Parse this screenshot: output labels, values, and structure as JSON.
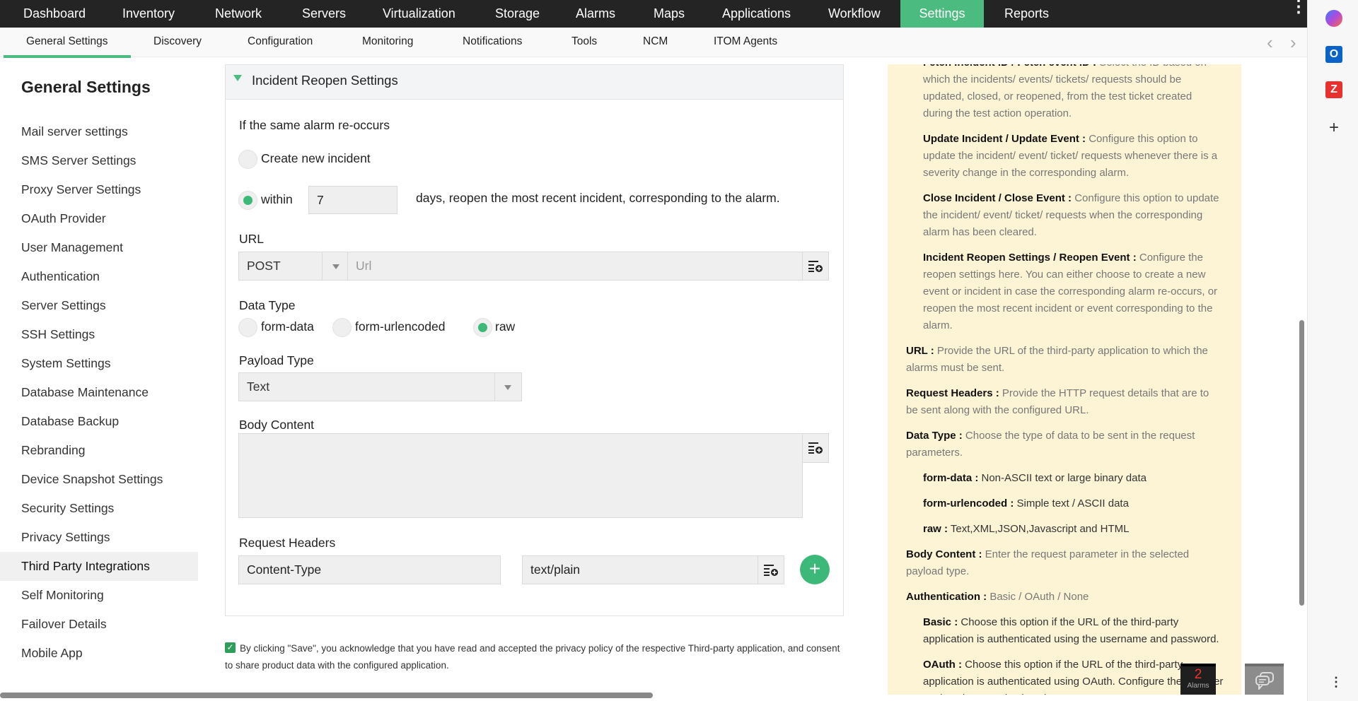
{
  "topnav": {
    "items": [
      "Dashboard",
      "Inventory",
      "Network",
      "Servers",
      "Virtualization",
      "Storage",
      "Alarms",
      "Maps",
      "Applications",
      "Workflow",
      "Settings",
      "Reports"
    ],
    "active": "Settings"
  },
  "subnav": {
    "items": [
      "General Settings",
      "Discovery",
      "Configuration",
      "Monitoring",
      "Notifications",
      "Tools",
      "NCM",
      "ITOM Agents"
    ],
    "active": "General Settings"
  },
  "sidebar": {
    "title": "General Settings",
    "items": [
      "Mail server settings",
      "SMS Server Settings",
      "Proxy Server Settings",
      "OAuth Provider",
      "User Management",
      "Authentication",
      "Server Settings",
      "SSH Settings",
      "System Settings",
      "Database Maintenance",
      "Database Backup",
      "Rebranding",
      "Device Snapshot Settings",
      "Security Settings",
      "Privacy Settings",
      "Third Party Integrations",
      "Self Monitoring",
      "Failover Details",
      "Mobile App"
    ],
    "selected": "Third Party Integrations"
  },
  "form": {
    "section_title": "Incident Reopen Settings",
    "reoccur_label": "If the same alarm re-occurs",
    "option_create": "Create new incident",
    "option_within": "within",
    "within_days": "7",
    "within_suffix": "days, reopen the most recent incident, corresponding to the alarm.",
    "url_label": "URL",
    "method": "POST",
    "url_placeholder": "Url",
    "data_type_label": "Data Type",
    "data_types": [
      "form-data",
      "form-urlencoded",
      "raw"
    ],
    "data_type_selected": "raw",
    "payload_label": "Payload Type",
    "payload_value": "Text",
    "body_label": "Body Content",
    "body_value": "",
    "headers_label": "Request Headers",
    "header_key": "Content-Type",
    "header_value": "text/plain",
    "consent": "By clicking \"Save\", you acknowledge that you have read and accepted the privacy policy of the respective Third-party application, and consent to share product data with the configured application.",
    "consent_checked": true
  },
  "help": [
    {
      "term": "Fetch Incident ID / Fetch event ID :",
      "desc": " Select the ID based on which the incidents/ events/ tickets/ requests should be updated, closed, or reopened, from the test ticket created during the test action operation.",
      "level": "sub"
    },
    {
      "term": "Update Incident / Update Event :",
      "desc": " Configure this option to update the incident/ event/ ticket/ requests whenever there is a severity change in the corresponding alarm.",
      "level": "sub"
    },
    {
      "term": "Close Incident / Close Event :",
      "desc": " Configure this option to update the incident/ event/ ticket/ requests when the corresponding alarm has been cleared.",
      "level": "sub"
    },
    {
      "term": "Incident Reopen Settings / Reopen Event :",
      "desc": " Configure the reopen settings here. You can either choose to create a new event or incident in case the corresponding alarm re-occurs, or reopen the most recent incident or event corresponding to the alarm.",
      "level": "sub"
    },
    {
      "term": "URL :",
      "desc": "  Provide the URL of the third-party application to which the alarms must be sent.",
      "level": "top"
    },
    {
      "term": "Request Headers :",
      "desc": "  Provide the HTTP request details that are to be sent along with the configured URL.",
      "level": "top"
    },
    {
      "term": "Data Type :",
      "desc": " Choose the type of data to be sent in the request parameters.",
      "level": "top"
    },
    {
      "term": "form-data :",
      "desc": " Non-ASCII text or large binary data",
      "level": "sub dark"
    },
    {
      "term": "form-urlencoded :",
      "desc": " Simple text / ASCII data",
      "level": "sub dark"
    },
    {
      "term": "raw :",
      "desc": " Text,XML,JSON,Javascript and HTML",
      "level": "sub dark"
    },
    {
      "term": "Body Content :",
      "desc": " Enter the request parameter in the selected payload type.",
      "level": "top"
    },
    {
      "term": "Authentication :",
      "desc": " Basic / OAuth / None",
      "level": "top"
    },
    {
      "term": "Basic :",
      "desc": " Choose this option if the URL of the third-party application is authenticated using the username and password.",
      "level": "sub dark"
    },
    {
      "term": "OAuth :",
      "desc": " Choose this option if the URL of the third-party application is authenticated using OAuth. Configure the provider settings here, and select them. ",
      "link": "Learn More.",
      "level": "sub dark"
    }
  ],
  "alarms": {
    "count": "2",
    "label": "Alarms"
  },
  "colors": {
    "accent": "#4cbb7f",
    "nav_bg": "#242424",
    "help_bg": "#fdf4d6"
  }
}
